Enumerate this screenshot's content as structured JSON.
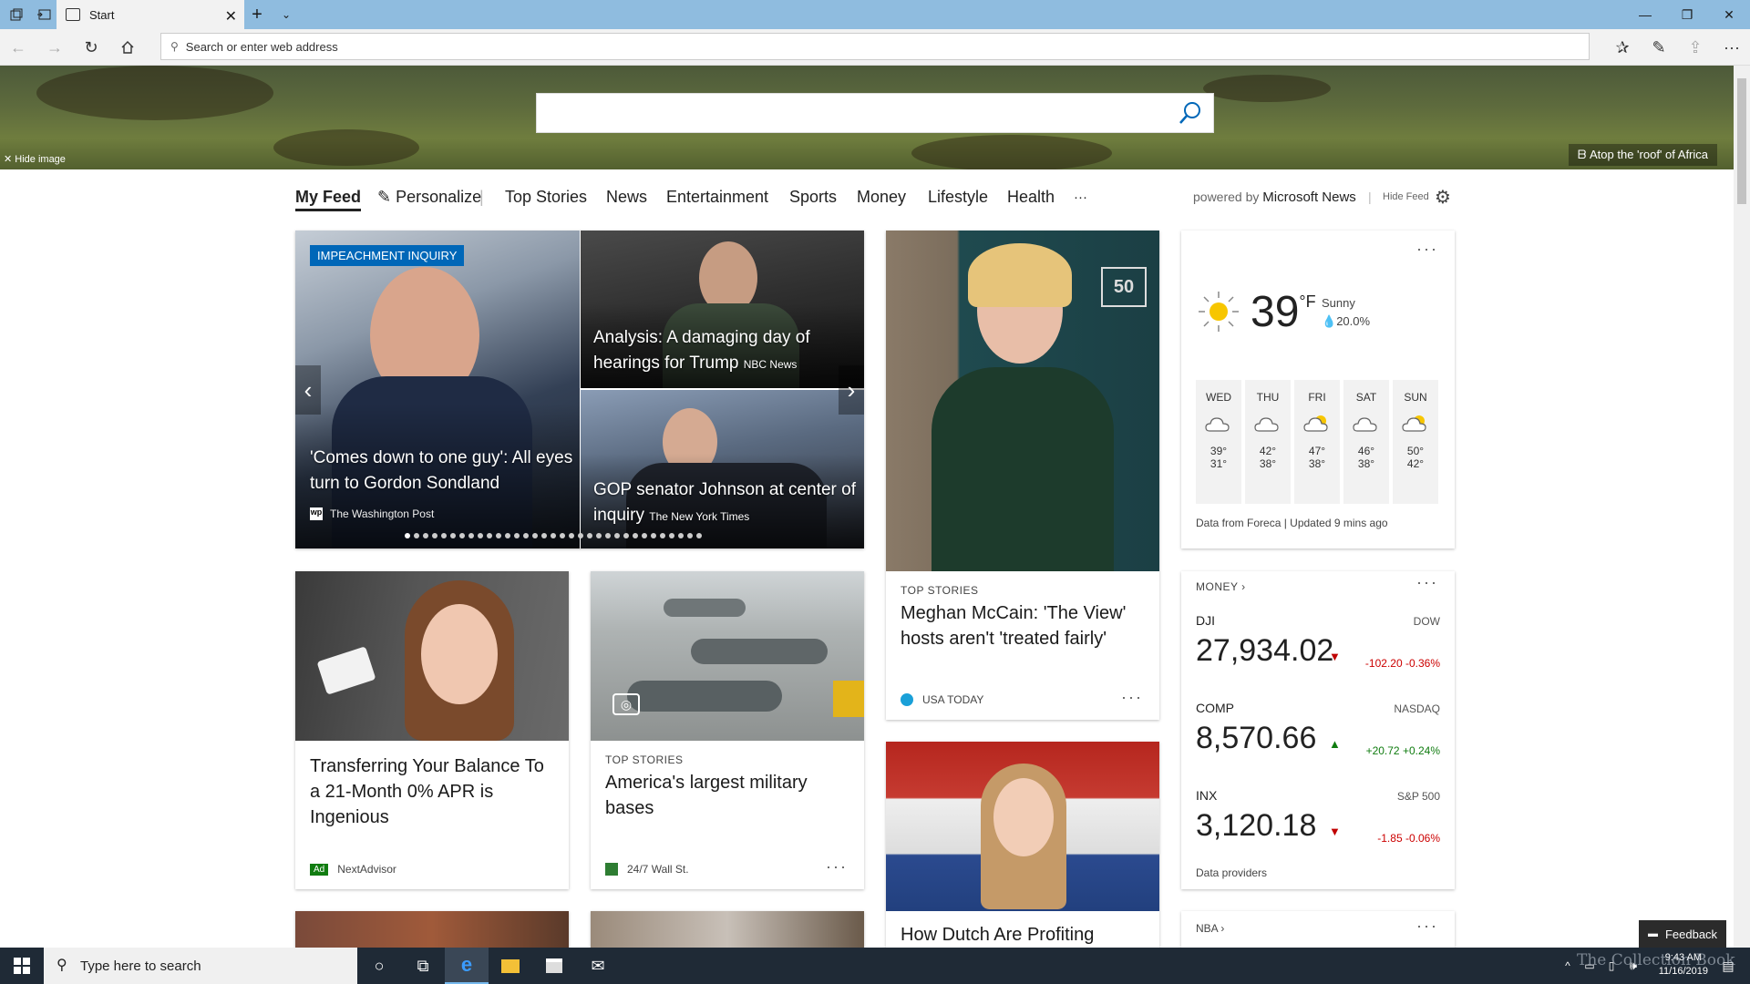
{
  "browser": {
    "tab_title": "Start",
    "address_placeholder": "Search or enter web address"
  },
  "hero": {
    "hide_image": "Hide image",
    "credit": "Atop the 'roof' of Africa"
  },
  "feednav": {
    "items": [
      "My Feed",
      "Personalize",
      "Top Stories",
      "News",
      "Entertainment",
      "Sports",
      "Money",
      "Lifestyle",
      "Health",
      "···"
    ],
    "powered_prefix": "powered by",
    "powered_brand": "Microsoft News",
    "hide_feed": "Hide Feed"
  },
  "carousel": {
    "badge": "IMPEACHMENT INQUIRY",
    "main_headline": "'Comes down to one guy': All eyes turn to Gordon Sondland",
    "main_source": "The Washington Post",
    "top_right_headline": "Analysis: A damaging day of hearings for Trump",
    "top_right_source": "NBC News",
    "bottom_right_headline": "GOP senator Johnson at center of inquiry",
    "bottom_right_source": "The New York Times"
  },
  "mccain_card": {
    "label": "TOP STORIES",
    "headline": "Meghan McCain: 'The View' hosts aren't 'treated fairly'",
    "source": "USA TODAY"
  },
  "weather": {
    "temp": "39",
    "unit": "°F",
    "condition": "Sunny",
    "precip": "20.0%",
    "days": [
      {
        "day": "WED",
        "hi": "39°",
        "lo": "31°",
        "icon": "cloud-icon"
      },
      {
        "day": "THU",
        "hi": "42°",
        "lo": "38°",
        "icon": "cloud-icon"
      },
      {
        "day": "FRI",
        "hi": "47°",
        "lo": "38°",
        "icon": "partly-sunny-icon"
      },
      {
        "day": "SAT",
        "hi": "46°",
        "lo": "38°",
        "icon": "cloud-icon"
      },
      {
        "day": "SUN",
        "hi": "50°",
        "lo": "42°",
        "icon": "partly-sunny-icon"
      }
    ],
    "footer": "Data from Foreca | Updated 9 mins ago"
  },
  "ad_card": {
    "headline": "Transferring Your Balance To a 21-Month 0% APR is Ingenious",
    "ad_badge": "Ad",
    "source": "NextAdvisor"
  },
  "bases_card": {
    "label": "TOP STORIES",
    "headline": "America's largest military bases",
    "source": "24/7 Wall St."
  },
  "dutch_card": {
    "headline": "How Dutch Are Profiting"
  },
  "money": {
    "title": "MONEY",
    "stocks": [
      {
        "name": "DJI",
        "exchange": "DOW",
        "value": "27,934.02",
        "direction": "down",
        "change": "-102.20",
        "pct": "-0.36%"
      },
      {
        "name": "COMP",
        "exchange": "NASDAQ",
        "value": "8,570.66",
        "direction": "up",
        "change": "+20.72",
        "pct": "+0.24%"
      },
      {
        "name": "INX",
        "exchange": "S&P 500",
        "value": "3,120.18",
        "direction": "down",
        "change": "-1.85",
        "pct": "-0.06%"
      }
    ],
    "providers": "Data providers"
  },
  "nba": {
    "title": "NBA"
  },
  "feedback": "Feedback",
  "taskbar": {
    "search_placeholder": "Type here to search",
    "time": "9:43 AM",
    "date": "11/16/2019"
  },
  "watermark": "The Collection Book",
  "colors": {
    "titlebar": "#8fbcdf",
    "badge": "#0067b8",
    "down": "#c00000",
    "up": "#107c10",
    "taskbar": "#1f2a36"
  }
}
